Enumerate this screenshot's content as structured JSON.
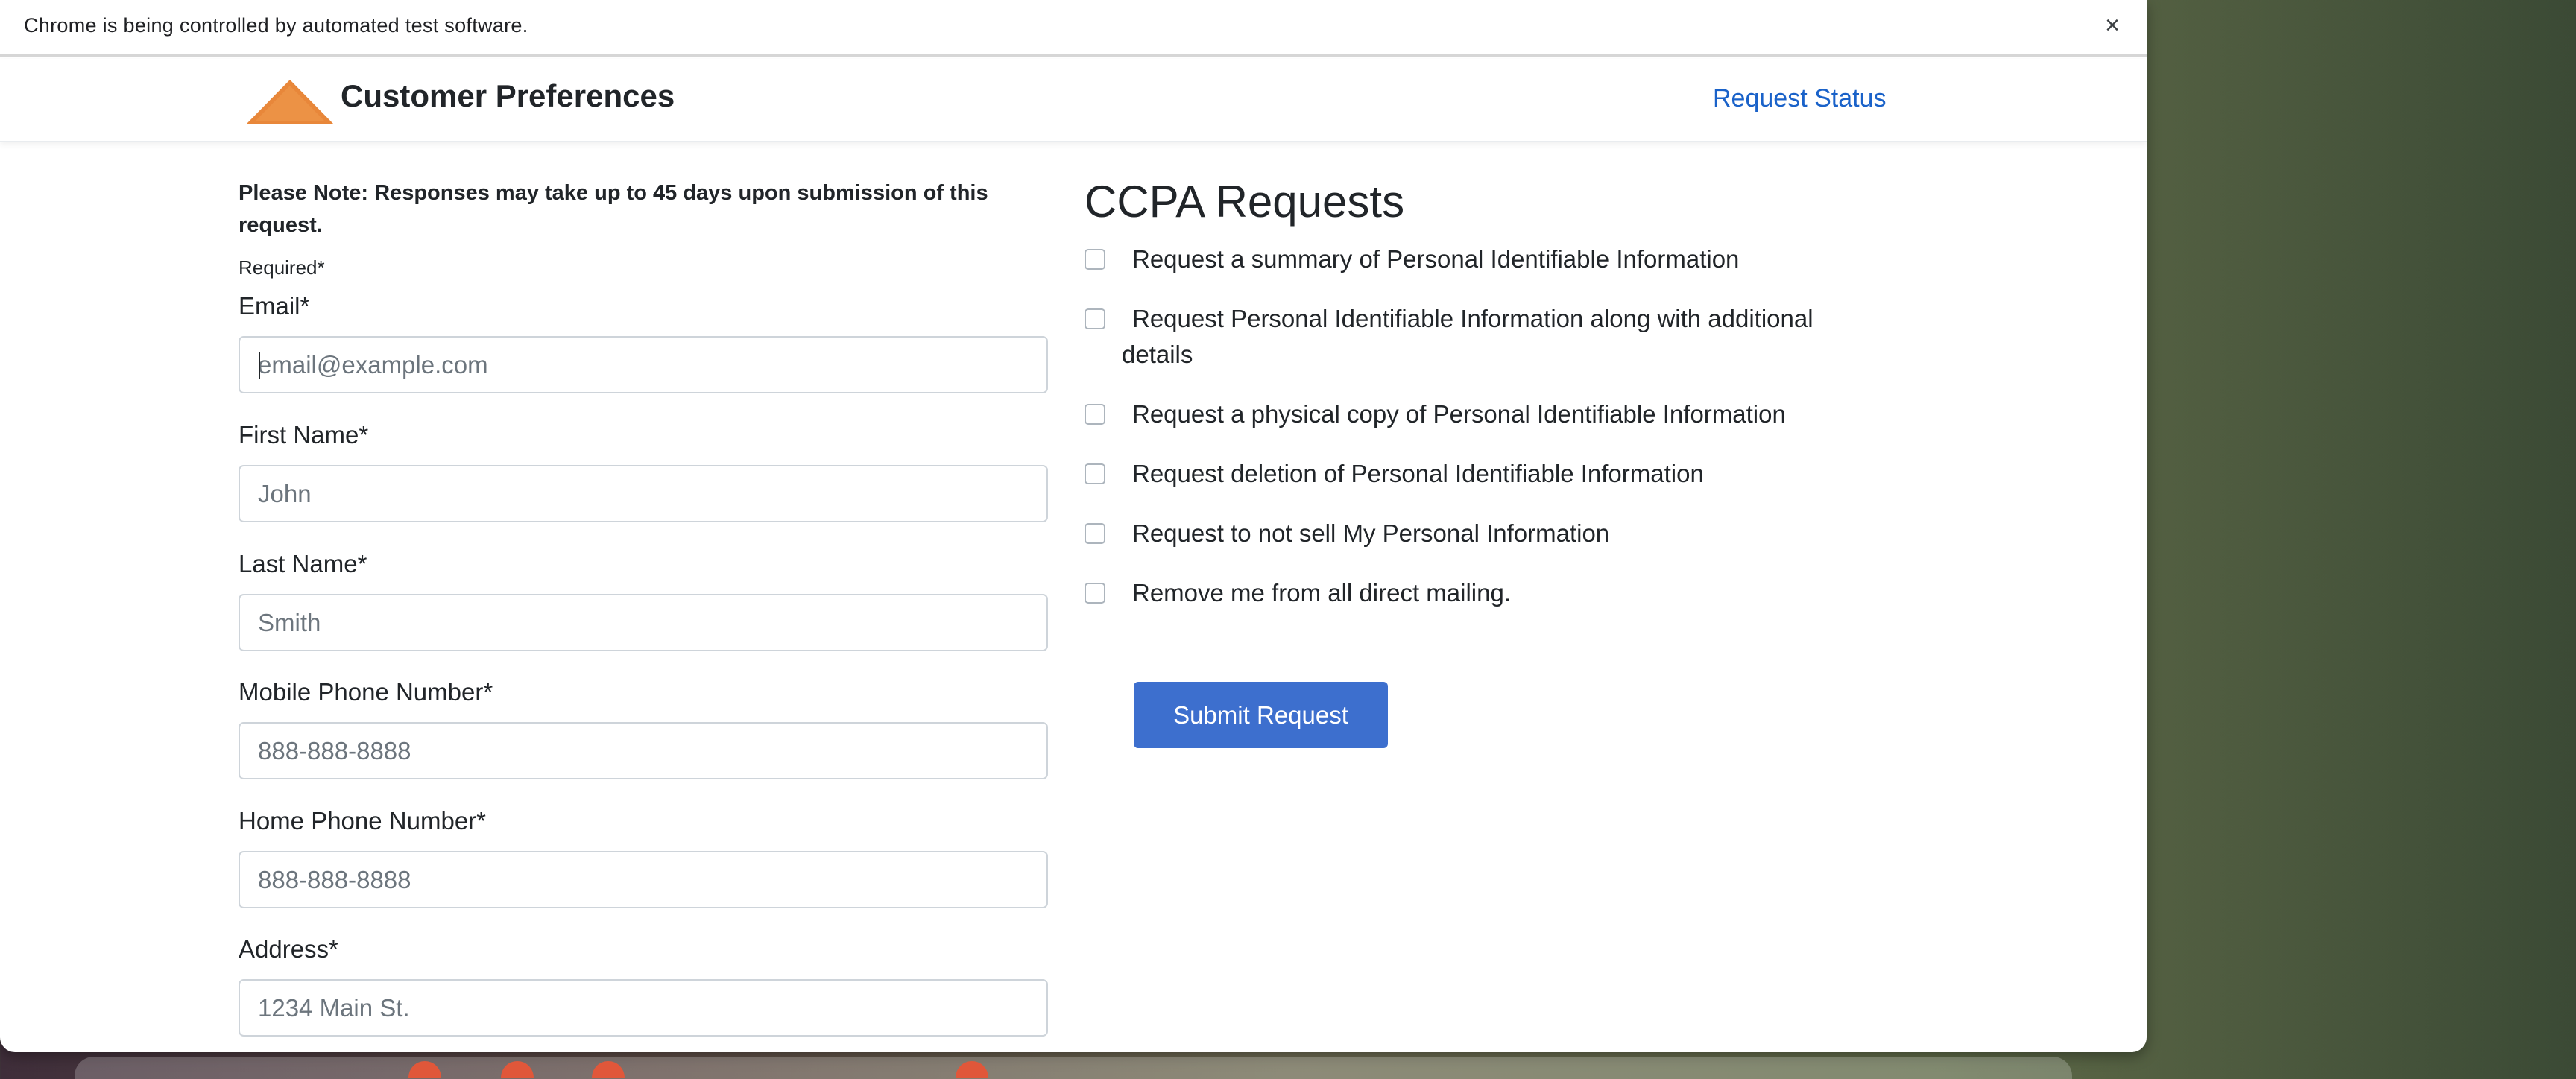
{
  "automation_bar": {
    "message": "Chrome is being controlled by automated test software.",
    "close_glyph": "×"
  },
  "navbar": {
    "logo_icon": "orange-triangle-logo",
    "brand_title": "Customer Preferences",
    "request_status_link": "Request Status"
  },
  "form": {
    "notice": "Please Note: Responses may take up to 45 days upon submission of this request.",
    "required_note": "Required*",
    "fields": [
      {
        "label": "Email*",
        "placeholder": "email@example.com",
        "value": ""
      },
      {
        "label": "First Name*",
        "placeholder": "John",
        "value": ""
      },
      {
        "label": "Last Name*",
        "placeholder": "Smith",
        "value": ""
      },
      {
        "label": "Mobile Phone Number*",
        "placeholder": "888-888-8888",
        "value": ""
      },
      {
        "label": "Home Phone Number*",
        "placeholder": "888-888-8888",
        "value": ""
      },
      {
        "label": "Address*",
        "placeholder": "1234 Main St.",
        "value": ""
      }
    ]
  },
  "ccpa": {
    "title": "CCPA Requests",
    "options": [
      {
        "label": "Request a summary of Personal Identifiable Information",
        "checked": false
      },
      {
        "label": "Request Personal Identifiable Information along with additional details",
        "checked": false
      },
      {
        "label": "Request a physical copy of Personal Identifiable Information",
        "checked": false
      },
      {
        "label": "Request deletion of Personal Identifiable Information",
        "checked": false
      },
      {
        "label": "Request to not sell My Personal Information",
        "checked": false
      },
      {
        "label": "Remove me from all direct mailing.",
        "checked": false
      }
    ],
    "submit_label": "Submit Request"
  },
  "colors": {
    "accent_orange": "#e8873a",
    "link_blue": "#1a62c9",
    "button_blue": "#3d6fce"
  }
}
